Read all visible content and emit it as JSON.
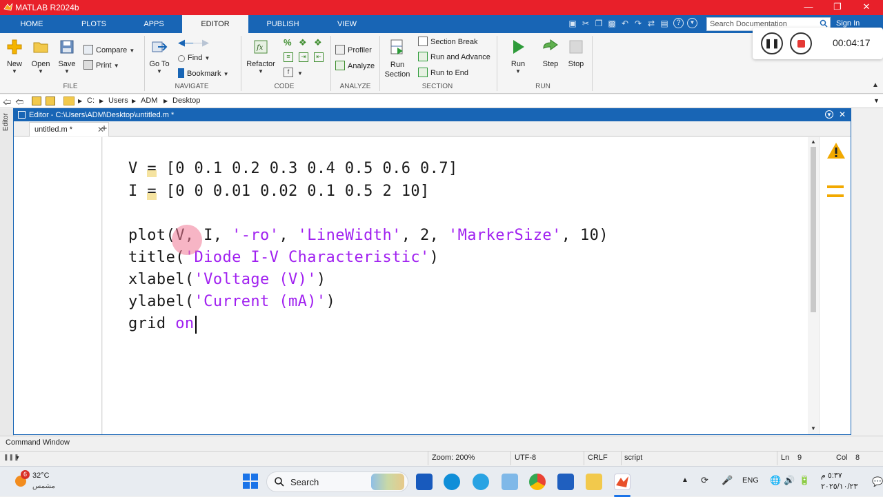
{
  "window": {
    "title": "MATLAB R2024b"
  },
  "ribbon_tabs": [
    "HOME",
    "PLOTS",
    "APPS",
    "EDITOR",
    "PUBLISH",
    "VIEW"
  ],
  "search": {
    "placeholder": "Search Documentation"
  },
  "sign_in": "Sign In",
  "recorder": {
    "time": "00:04:17"
  },
  "ribbon": {
    "file": {
      "label": "FILE",
      "new": "New",
      "open": "Open",
      "save": "Save",
      "compare": "Compare",
      "print": "Print"
    },
    "navigate": {
      "label": "NAVIGATE",
      "goto": "Go To",
      "find": "Find",
      "bookmark": "Bookmark"
    },
    "code": {
      "label": "CODE",
      "refactor": "Refactor"
    },
    "analyze": {
      "label": "ANALYZE",
      "profiler": "Profiler",
      "analyze": "Analyze"
    },
    "section": {
      "label": "SECTION",
      "run_section": "Run Section",
      "section_break": "Section Break",
      "run_advance": "Run and Advance",
      "run_end": "Run to End"
    },
    "run": {
      "label": "RUN",
      "run": "Run",
      "step": "Step",
      "stop": "Stop"
    }
  },
  "address": {
    "drive": "C:",
    "crumbs": [
      "Users",
      "ADM",
      "Desktop"
    ]
  },
  "editor": {
    "panel_title": "Editor - C:\\Users\\ADM\\Desktop\\untitled.m *",
    "side_label": "Editor",
    "tab_label": "untitled.m *",
    "code": {
      "l1_var": "V",
      "l1_eq": "=",
      "l1_rest": " [0 0.1 0.2 0.3 0.4 0.5 0.6 0.7]",
      "l2_var": "I",
      "l2_eq": "=",
      "l2_rest": " [0 0 0.01 0.02 0.1 0.5 2 10]",
      "l3_a": "plot(V, I, ",
      "l3_s1": "'-ro'",
      "l3_b": ", ",
      "l3_s2": "'LineWidth'",
      "l3_c": ", 2, ",
      "l3_s3": "'MarkerSize'",
      "l3_d": ", 10)",
      "l4_a": "title(",
      "l4_s": "'Diode I-V Characteristic'",
      "l4_b": ")",
      "l5_a": "xlabel(",
      "l5_s": "'Voltage (V)'",
      "l5_b": ")",
      "l6_a": "ylabel(",
      "l6_s": "'Current (mA)'",
      "l6_b": ")",
      "l7_a": "grid ",
      "l7_kw": "on"
    }
  },
  "command_window": {
    "label": "Command Window"
  },
  "status": {
    "zoom": "Zoom: 200%",
    "encoding": "UTF-8",
    "eol": "CRLF",
    "type": "script",
    "ln_label": "Ln",
    "ln": "9",
    "col_label": "Col",
    "col": "8"
  },
  "taskbar": {
    "weather_temp": "32°C",
    "weather_desc": "مشمس",
    "weather_badge": "6",
    "search": "Search",
    "lang": "ENG",
    "time": "٥:٣٧ م",
    "date": "٢٠٢٥/١٠/٢٣"
  },
  "colors": {
    "brand_red": "#e8202a",
    "tab_blue": "#1865b5",
    "string_purple": "#a020f0"
  }
}
